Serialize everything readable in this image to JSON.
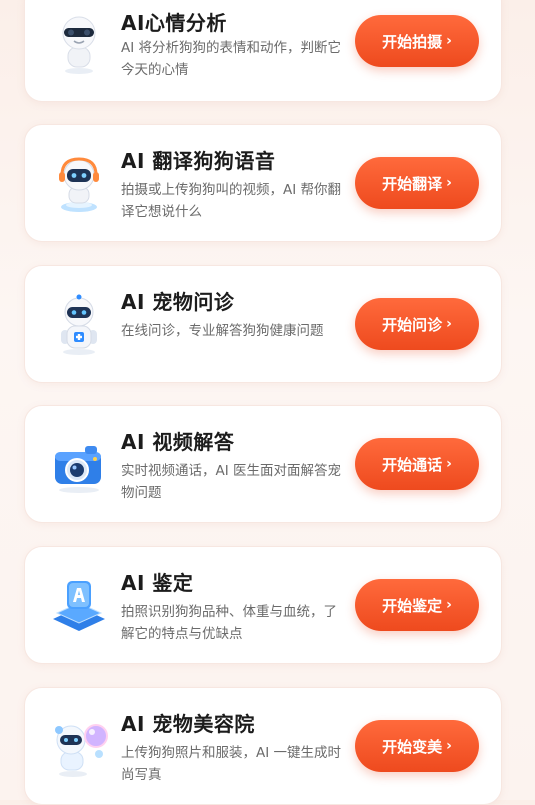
{
  "cards": [
    {
      "title": "AI心情分析",
      "description": "AI 将分析狗狗的表情和动作，判断它今天的心情",
      "button_label": "开始拍摄",
      "icon": "robot-sunglasses-icon"
    },
    {
      "title": "AI 翻译狗狗语音",
      "description": "拍摄或上传狗狗叫的视频，AI 帮你翻译它想说什么",
      "button_label": "开始翻译",
      "icon": "robot-headset-icon"
    },
    {
      "title": "AI 宠物问诊",
      "description": "在线问诊，专业解答狗狗健康问题",
      "button_label": "开始问诊",
      "icon": "robot-doctor-icon"
    },
    {
      "title": "AI 视频解答",
      "description": "实时视频通话，AI 医生面对面解答宠物问题",
      "button_label": "开始通话",
      "icon": "camera-icon"
    },
    {
      "title": "AI 鉴定",
      "description": "拍照识别狗狗品种、体重与血统，了解它的特点与优缺点",
      "button_label": "开始鉴定",
      "icon": "ai-chip-icon"
    },
    {
      "title": "AI 宠物美容院",
      "description": "上传狗狗照片和服装，AI 一键生成时尚写真",
      "button_label": "开始变美",
      "icon": "robot-bubble-icon"
    }
  ],
  "chevron": "›",
  "colors": {
    "accent": "#f05323",
    "title": "#1c1c1c",
    "description": "#6b6b6b",
    "icon_blue": "#2f8cff"
  }
}
